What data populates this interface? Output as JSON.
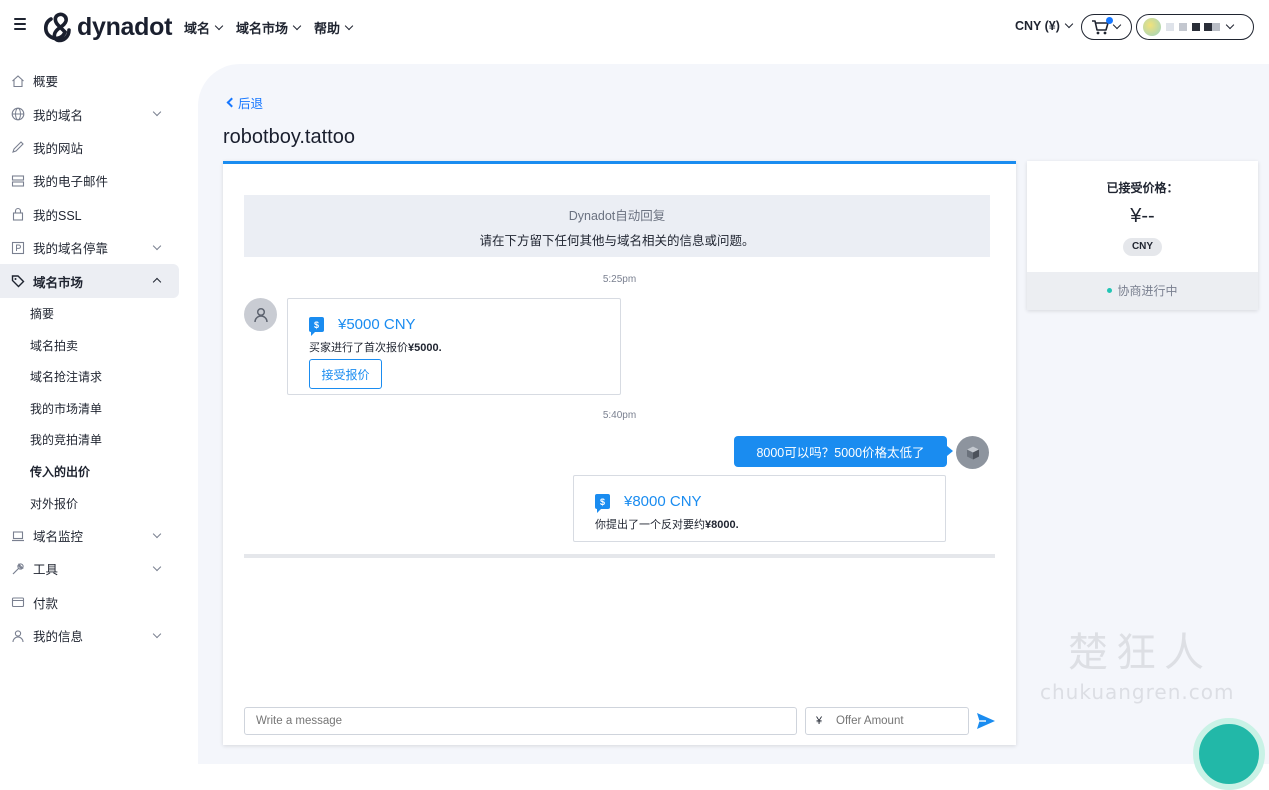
{
  "header": {
    "logo_text": "dynadot",
    "nav": [
      "域名",
      "域名市场",
      "帮助"
    ],
    "currency": "CNY (¥)",
    "icons": {
      "menu": "hamburger-icon",
      "cart": "cart-icon",
      "account": "avatar-icon"
    }
  },
  "sidebar": {
    "items": [
      {
        "label": "概要",
        "icon": "home-icon",
        "expandable": false
      },
      {
        "label": "我的域名",
        "icon": "globe-icon",
        "expandable": true
      },
      {
        "label": "我的网站",
        "icon": "pen-icon",
        "expandable": false
      },
      {
        "label": "我的电子邮件",
        "icon": "inbox-icon",
        "expandable": false
      },
      {
        "label": "我的SSL",
        "icon": "lock-icon",
        "expandable": false
      },
      {
        "label": "我的域名停靠",
        "icon": "parking-icon",
        "expandable": true
      },
      {
        "label": "域名市场",
        "icon": "tag-icon",
        "expandable": true,
        "active": true
      }
    ],
    "sub_items": [
      "摘要",
      "域名拍卖",
      "域名抢注请求",
      "我的市场清单",
      "我的竞拍清单",
      "传入的出价",
      "对外报价"
    ],
    "current_sub": "传入的出价",
    "bottom_items": [
      {
        "label": "域名监控",
        "icon": "laptop-icon",
        "expandable": true
      },
      {
        "label": "工具",
        "icon": "wrench-icon",
        "expandable": true
      },
      {
        "label": "付款",
        "icon": "wallet-icon",
        "expandable": false
      },
      {
        "label": "我的信息",
        "icon": "user-icon",
        "expandable": true
      }
    ]
  },
  "page": {
    "back_label": "后退",
    "domain": "robotboy.tattoo"
  },
  "chat": {
    "auto_reply_title": "Dynadot自动回复",
    "auto_reply_body": "请在下方留下任何其他与域名相关的信息或问题。",
    "time1": "5:25pm",
    "buyer_offer": {
      "amount": "¥5000 CNY",
      "desc_prefix": "买家进行了首次报价",
      "desc_value": "¥5000.",
      "accept_label": "接受报价"
    },
    "time2": "5:40pm",
    "my_message": "8000可以吗？5000价格太低了",
    "counter_offer": {
      "amount": "¥8000 CNY",
      "desc_prefix": "你提出了一个反对要约",
      "desc_value": "¥8000."
    },
    "message_placeholder": "Write a message",
    "offer_currency": "¥",
    "offer_placeholder": "Offer Amount"
  },
  "price_panel": {
    "label": "已接受价格：",
    "value": "¥--",
    "currency_badge": "CNY",
    "status": "协商进行中",
    "status_color": "#22c5b5"
  },
  "colors": {
    "accent": "#1a8cf0",
    "sidebar_active_bg": "#eceef3",
    "main_bg": "#f4f6fb"
  },
  "watermark": {
    "cn": "楚狂人",
    "en": "chukuangren.com"
  }
}
